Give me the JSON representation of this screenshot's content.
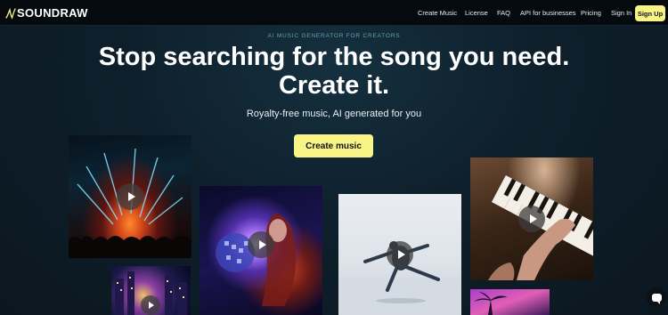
{
  "header": {
    "logo_text": "SOUNDRAW",
    "nav": [
      {
        "label": "Create Music"
      },
      {
        "label": "License"
      },
      {
        "label": "FAQ"
      },
      {
        "label": "API for businesses"
      },
      {
        "label": "Pricing"
      },
      {
        "label": "Sign In"
      }
    ],
    "signup_label": "Sign Up"
  },
  "hero": {
    "eyebrow": "AI MUSIC GENERATOR FOR CREATORS",
    "headline_line1": "Stop searching for the song you need.",
    "headline_line2": "Create it.",
    "subline": "Royalty-free music, AI generated for you",
    "cta_label": "Create music"
  },
  "tiles": [
    {
      "name": "concert-lights",
      "icon": "play-icon"
    },
    {
      "name": "disco-ball-woman",
      "icon": "play-icon"
    },
    {
      "name": "jumping-dancer",
      "icon": "play-icon"
    },
    {
      "name": "piano-hands",
      "icon": "play-icon"
    },
    {
      "name": "city-night",
      "icon": "play-icon"
    },
    {
      "name": "palm-sunset",
      "icon": "none"
    }
  ],
  "colors": {
    "accent": "#f8f586",
    "header_bg": "#050a0f",
    "page_bg": "#0d1a24",
    "eyebrow": "#6d9fb8"
  },
  "chat": {
    "icon": "chat-icon"
  }
}
